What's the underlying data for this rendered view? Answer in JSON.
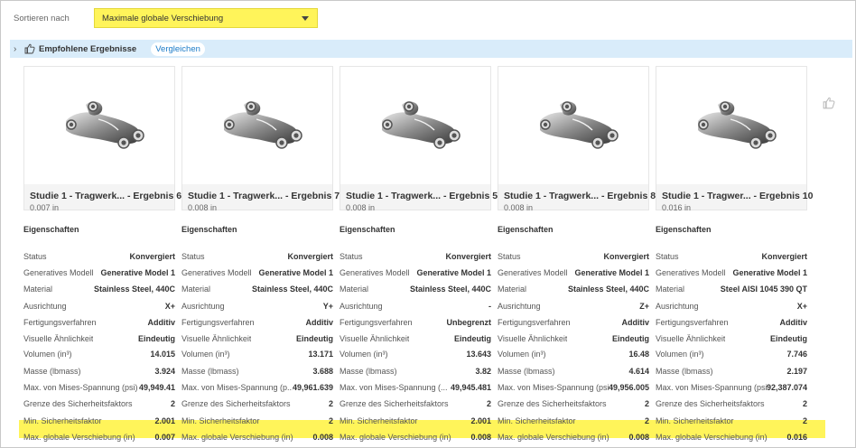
{
  "sort": {
    "label": "Sortieren nach",
    "value": "Maximale globale Verschiebung"
  },
  "recommended": {
    "title": "Empfohlene Ergebnisse",
    "compare_label": "Vergleichen"
  },
  "properties_header": "Eigenschaften",
  "row_labels": [
    "Status",
    "Generatives Modell",
    "Material",
    "Ausrichtung",
    "Fertigungsverfahren",
    "Visuelle Ähnlichkeit",
    "Volumen (in³)",
    "Masse (lbmass)",
    "Max. von Mises-Spannung (psi)",
    "Grenze des Sicherheitsfaktors",
    "Min. Sicherheitsfaktor",
    "Max. globale Verschiebung (in)"
  ],
  "row_labels_short": [
    "Status",
    "Generatives Modell",
    "Material",
    "Ausrichtung",
    "Fertigungsverfahren",
    "Visuelle Ähnlichkeit",
    "Volumen (in³)",
    "Masse (lbmass)",
    "Max. von Mises-Spannung (p...",
    "Grenze des Sicherheitsfaktors",
    "Min. Sicherheitsfaktor",
    "Max. globale Verschiebung (in)"
  ],
  "row_labels_short2": [
    "Status",
    "Generatives Modell",
    "Material",
    "Ausrichtung",
    "Fertigungsverfahren",
    "Visuelle Ähnlichkeit",
    "Volumen (in³)",
    "Masse (lbmass)",
    "Max. von Mises-Spannung (...",
    "Grenze des Sicherheitsfaktors",
    "Min. Sicherheitsfaktor",
    "Max. globale Verschiebung (in)"
  ],
  "results": [
    {
      "title": "Studie 1 - Tragwerk... - Ergebnis 6",
      "sub": "0.007 in",
      "values": [
        "Konvergiert",
        "Generative Model 1",
        "Stainless Steel, 440C",
        "X+",
        "Additiv",
        "Eindeutig",
        "14.015",
        "3.924",
        "49,949.41",
        "2",
        "2.001",
        "0.007"
      ]
    },
    {
      "title": "Studie 1 - Tragwerk... - Ergebnis 7",
      "sub": "0.008 in",
      "values": [
        "Konvergiert",
        "Generative Model 1",
        "Stainless Steel, 440C",
        "Y+",
        "Additiv",
        "Eindeutig",
        "13.171",
        "3.688",
        "49,961.639",
        "2",
        "2",
        "0.008"
      ]
    },
    {
      "title": "Studie 1 - Tragwerk... - Ergebnis 5",
      "sub": "0.008 in",
      "values": [
        "Konvergiert",
        "Generative Model 1",
        "Stainless Steel, 440C",
        "-",
        "Unbegrenzt",
        "Eindeutig",
        "13.643",
        "3.82",
        "49,945.481",
        "2",
        "2.001",
        "0.008"
      ]
    },
    {
      "title": "Studie 1 - Tragwerk... - Ergebnis 8",
      "sub": "0.008 in",
      "values": [
        "Konvergiert",
        "Generative Model 1",
        "Stainless Steel, 440C",
        "Z+",
        "Additiv",
        "Eindeutig",
        "16.48",
        "4.614",
        "49,956.005",
        "2",
        "2",
        "0.008"
      ]
    },
    {
      "title": "Studie 1 - Tragwer... - Ergebnis 10",
      "sub": "0.016 in",
      "values": [
        "Konvergiert",
        "Generative Model 1",
        "Steel AISI 1045 390 QT",
        "X+",
        "Additiv",
        "Eindeutig",
        "7.746",
        "2.197",
        "92,387.074",
        "2",
        "2",
        "0.016"
      ]
    }
  ],
  "colors": {
    "highlight": "#fff45a",
    "recommended_bar": "#d9ecfa",
    "link": "#1a7bc8"
  },
  "icons": {
    "expand": "chevron-right-icon",
    "recommended": "thumbs-up-icon",
    "favorite": "thumbs-up-icon",
    "dropdown": "caret-down-icon"
  }
}
